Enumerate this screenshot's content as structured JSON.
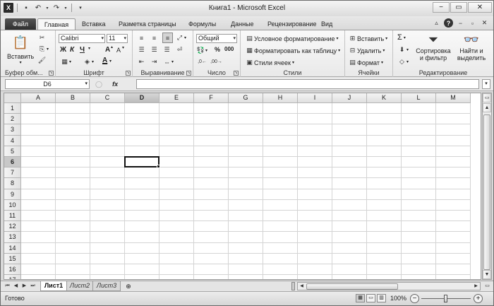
{
  "window": {
    "title": "Книга1  -  Microsoft Excel"
  },
  "qat": {
    "app_icon": "X",
    "save_icon": "save-icon",
    "undo_icon": "undo-icon",
    "redo_icon": "redo-icon"
  },
  "tabs": [
    {
      "label": "Файл"
    },
    {
      "label": "Главная"
    },
    {
      "label": "Вставка"
    },
    {
      "label": "Разметка страницы"
    },
    {
      "label": "Формулы"
    },
    {
      "label": "Данные"
    },
    {
      "label": "Рецензирование"
    },
    {
      "label": "Вид"
    }
  ],
  "ribbon": {
    "clipboard": {
      "label": "Буфер обм...",
      "paste": "Вставить"
    },
    "font": {
      "label": "Шрифт",
      "name": "Calibri",
      "size": "11",
      "bold": "Ж",
      "italic": "К",
      "underline": "Ч",
      "grow": "A",
      "shrink": "A",
      "fontcolor": "A"
    },
    "alignment": {
      "label": "Выравнивание"
    },
    "number": {
      "label": "Число",
      "format": "Общий",
      "percent": "%",
      "thousands": "000"
    },
    "styles": {
      "label": "Стили",
      "conditional": "Условное форматирование",
      "as_table": "Форматировать как таблицу",
      "cell_styles": "Стили ячеек"
    },
    "cells": {
      "label": "Ячейки",
      "insert": "Вставить",
      "delete": "Удалить",
      "format": "Формат"
    },
    "editing": {
      "label": "Редактирование",
      "sum": "Σ",
      "sort_line1": "Сортировка",
      "sort_line2": "и фильтр",
      "find_line1": "Найти и",
      "find_line2": "выделить"
    }
  },
  "formula_bar": {
    "name_box": "D6",
    "fx": "fx",
    "value": ""
  },
  "grid": {
    "columns": [
      "A",
      "B",
      "C",
      "D",
      "E",
      "F",
      "G",
      "H",
      "I",
      "J",
      "K",
      "L",
      "M"
    ],
    "rows": [
      "1",
      "2",
      "3",
      "4",
      "5",
      "6",
      "7",
      "8",
      "9",
      "10",
      "11",
      "12",
      "13",
      "14",
      "15",
      "16",
      "17"
    ],
    "active_cell": "D6",
    "selected_col": "D",
    "selected_row": "6"
  },
  "sheets": [
    {
      "label": "Лист1"
    },
    {
      "label": "Лист2"
    },
    {
      "label": "Лист3"
    }
  ],
  "status": {
    "text": "Готово",
    "zoom": "100%",
    "minus": "−",
    "plus": "+"
  }
}
